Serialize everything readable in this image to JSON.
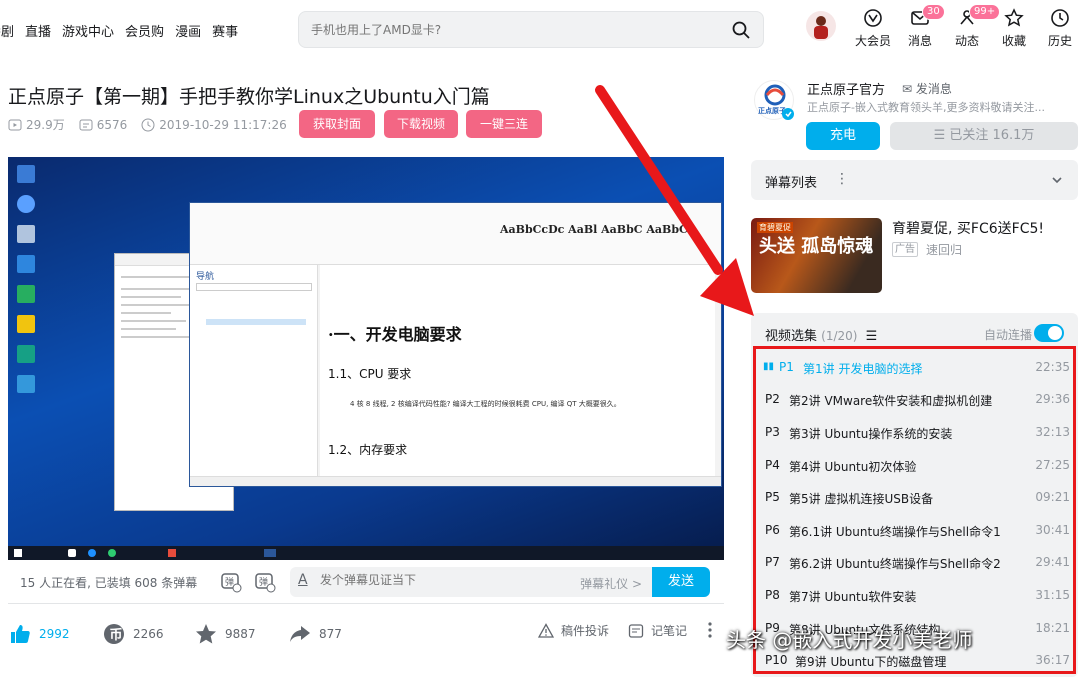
{
  "header": {
    "nav": [
      "番剧",
      "直播",
      "游戏中心",
      "会员购",
      "漫画",
      "赛事"
    ],
    "search_placeholder": "手机也用上了AMD显卡?",
    "items": [
      {
        "label": "大会员",
        "icon": "vip-icon",
        "badge": ""
      },
      {
        "label": "消息",
        "icon": "message-icon",
        "badge": "30"
      },
      {
        "label": "动态",
        "icon": "dynamic-icon",
        "badge": "99+"
      },
      {
        "label": "收藏",
        "icon": "star-icon",
        "badge": ""
      },
      {
        "label": "历史",
        "icon": "clock-icon",
        "badge": ""
      }
    ]
  },
  "video": {
    "title": "正点原子【第一期】手把手教你学Linux之Ubuntu入门篇",
    "views": "29.9万",
    "danmaku": "6576",
    "date": "2019-10-29 11:17:26",
    "buttons": [
      "获取封面",
      "下载视频",
      "一键三连"
    ]
  },
  "player_content": {
    "doc_h1": "·一、开发电脑要求",
    "doc_h2": "1.1、CPU 要求",
    "doc_p": "4 核 8 线程, 2 核编译代码性能? 编译大工程的时候很耗费 CPU, 编译 QT 大概要很久。",
    "doc_h3": "1.2、内存要求",
    "nav_title": "导航"
  },
  "danmaku_bar": {
    "online": "15 人正在看, 已装填 608 条弹幕",
    "input_placeholder": "发个弹幕见证当下",
    "etiquette": "弹幕礼仪 >",
    "send": "发送"
  },
  "actions": {
    "like": "2992",
    "coin": "2266",
    "fav": "9887",
    "share": "877",
    "report": "稿件投诉",
    "notes": "记笔记"
  },
  "uploader": {
    "name": "正点原子官方",
    "message": "发消息",
    "desc": "正点原子-嵌入式教育领头羊,更多资料敬请关注...",
    "charge": "充电",
    "followed": "已关注 16.1万",
    "logo_text": "正点原子"
  },
  "danmaku_list": {
    "title": "弹幕列表"
  },
  "ad": {
    "title": "育碧夏促, 买FC6送FC5!",
    "tag": "广告",
    "sub": "速回归",
    "img_text": "头送 孤岛惊魂",
    "img_badge": "育碧夏促"
  },
  "episodes": {
    "title": "视频选集",
    "count": "(1/20)",
    "autoplay": "自动连播",
    "autoplay_on": true,
    "items": [
      {
        "no": "P1",
        "name": "第1讲 开发电脑的选择",
        "dur": "22:35",
        "active": true
      },
      {
        "no": "P2",
        "name": "第2讲 VMware软件安装和虚拟机创建",
        "dur": "29:36"
      },
      {
        "no": "P3",
        "name": "第3讲 Ubuntu操作系统的安装",
        "dur": "32:13"
      },
      {
        "no": "P4",
        "name": "第4讲 Ubuntu初次体验",
        "dur": "27:25"
      },
      {
        "no": "P5",
        "name": "第5讲 虚拟机连接USB设备",
        "dur": "09:21"
      },
      {
        "no": "P6",
        "name": "第6.1讲 Ubuntu终端操作与Shell命令1",
        "dur": "30:41"
      },
      {
        "no": "P7",
        "name": "第6.2讲 Ubuntu终端操作与Shell命令2",
        "dur": "29:41"
      },
      {
        "no": "P8",
        "name": "第7讲 Ubuntu软件安装",
        "dur": "31:15"
      },
      {
        "no": "P9",
        "name": "第8讲 Ubuntu文件系统结构",
        "dur": "18:21"
      },
      {
        "no": "P10",
        "name": "第9讲 Ubuntu下的磁盘管理",
        "dur": "36:17"
      }
    ]
  },
  "watermark": "头条 @嵌入式开发小美老师",
  "colors": {
    "accent": "#00aeec",
    "pink": "#f36684",
    "red_annotation": "#e8181a"
  }
}
